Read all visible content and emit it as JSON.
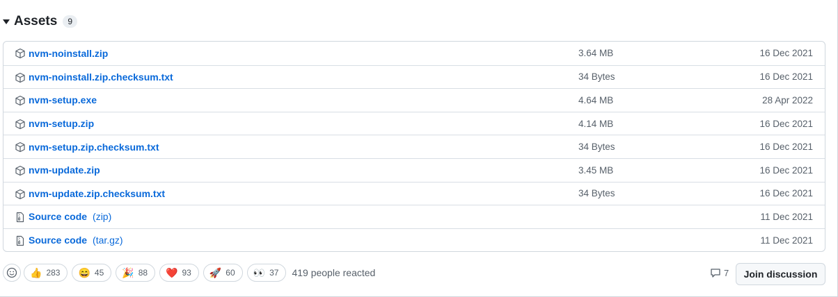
{
  "assets": {
    "title": "Assets",
    "count": "9",
    "rows": [
      {
        "name": "nvm-noinstall.zip",
        "suffix": "",
        "size": "3.64 MB",
        "date": "16 Dec 2021",
        "icon": "package-icon"
      },
      {
        "name": "nvm-noinstall.zip.checksum.txt",
        "suffix": "",
        "size": "34 Bytes",
        "date": "16 Dec 2021",
        "icon": "package-icon"
      },
      {
        "name": "nvm-setup.exe",
        "suffix": "",
        "size": "4.64 MB",
        "date": "28 Apr 2022",
        "icon": "package-icon"
      },
      {
        "name": "nvm-setup.zip",
        "suffix": "",
        "size": "4.14 MB",
        "date": "16 Dec 2021",
        "icon": "package-icon"
      },
      {
        "name": "nvm-setup.zip.checksum.txt",
        "suffix": "",
        "size": "34 Bytes",
        "date": "16 Dec 2021",
        "icon": "package-icon"
      },
      {
        "name": "nvm-update.zip",
        "suffix": "",
        "size": "3.45 MB",
        "date": "16 Dec 2021",
        "icon": "package-icon"
      },
      {
        "name": "nvm-update.zip.checksum.txt",
        "suffix": "",
        "size": "34 Bytes",
        "date": "16 Dec 2021",
        "icon": "package-icon"
      },
      {
        "name": "Source code",
        "suffix": "(zip)",
        "size": "",
        "date": "11 Dec 2021",
        "icon": "file-zip-icon"
      },
      {
        "name": "Source code",
        "suffix": "(tar.gz)",
        "size": "",
        "date": "11 Dec 2021",
        "icon": "file-zip-icon"
      }
    ]
  },
  "reactions": {
    "items": [
      {
        "emoji": "👍",
        "icon": "thumbs-up-icon",
        "count": "283"
      },
      {
        "emoji": "😄",
        "icon": "laugh-icon",
        "count": "45"
      },
      {
        "emoji": "🎉",
        "icon": "hooray-icon",
        "count": "88"
      },
      {
        "emoji": "❤️",
        "icon": "heart-icon",
        "count": "93"
      },
      {
        "emoji": "🚀",
        "icon": "rocket-icon",
        "count": "60"
      },
      {
        "emoji": "👀",
        "icon": "eyes-icon",
        "count": "37"
      }
    ],
    "summary": "419 people reacted"
  },
  "discussion": {
    "comment_count": "7",
    "join_label": "Join discussion"
  },
  "colors": {
    "link": "#0969da",
    "muted": "#57606a",
    "border": "#d0d7de"
  }
}
